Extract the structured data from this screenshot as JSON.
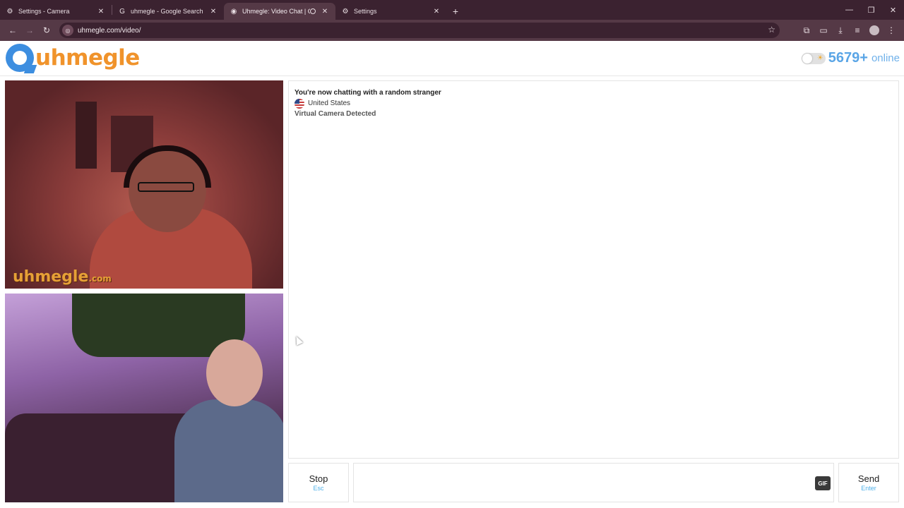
{
  "browser": {
    "tabs": [
      {
        "label": "Settings - Camera",
        "icon": "gear-icon",
        "active": false
      },
      {
        "label": "uhmegle - Google Search",
        "icon": "google-icon",
        "active": false
      },
      {
        "label": "Uhmegle: Video Chat | Ome",
        "icon": "uhmegle-icon",
        "active": true
      },
      {
        "label": "Settings",
        "icon": "gear-icon",
        "active": false
      }
    ],
    "new_tab": "+",
    "url": "uhmegle.com/video/"
  },
  "header": {
    "logo_text": "uhmegle",
    "online_count": "5679+",
    "online_label": "online"
  },
  "stranger_video": {
    "watermark": "uhmegle",
    "watermark_suffix": ".com"
  },
  "chat": {
    "status": "You're now chatting with a random stranger",
    "country": "United States",
    "warning": "Virtual Camera Detected"
  },
  "controls": {
    "stop_label": "Stop",
    "stop_shortcut": "Esc",
    "gif_label": "GIF",
    "send_label": "Send",
    "send_shortcut": "Enter"
  }
}
